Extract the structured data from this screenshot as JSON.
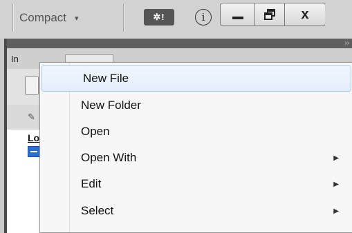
{
  "toolbar": {
    "workspace_label": "Compact",
    "workspace_caret": "▾",
    "crash_icon_text": "✲!",
    "info_icon_text": "i"
  },
  "window_controls": {
    "close_glyph": "x"
  },
  "panel": {
    "collapse_glyph": "››",
    "tab_label": "In",
    "column_header": "Lo"
  },
  "context_menu": {
    "items": [
      {
        "label": "New File",
        "has_submenu": false,
        "highlighted": true
      },
      {
        "label": "New Folder",
        "has_submenu": false,
        "highlighted": false
      },
      {
        "label": "Open",
        "has_submenu": false,
        "highlighted": false
      },
      {
        "label": "Open With",
        "has_submenu": true,
        "highlighted": false
      },
      {
        "label": "Edit",
        "has_submenu": true,
        "highlighted": false
      },
      {
        "label": "Select",
        "has_submenu": true,
        "highlighted": false
      }
    ],
    "submenu_arrow": "▶"
  }
}
